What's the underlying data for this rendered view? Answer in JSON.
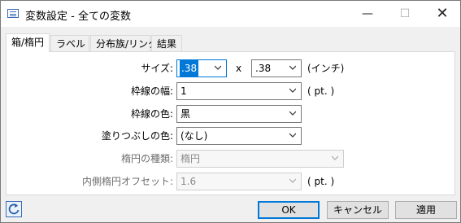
{
  "window": {
    "title": "変数設定 - 全ての変数"
  },
  "titlebar": {
    "minimize": "—",
    "maximize": "☐",
    "close": "✕"
  },
  "tabs": [
    {
      "label": "箱/楕円",
      "active": true
    },
    {
      "label": "ラベル",
      "active": false
    },
    {
      "label": "分布族/リンク",
      "active": false
    },
    {
      "label": "結果",
      "active": false
    }
  ],
  "form": {
    "size": {
      "label": "サイズ:",
      "w": ".38",
      "sep": "x",
      "h": ".38",
      "unit": "(インチ)"
    },
    "border_width": {
      "label": "枠線の幅:",
      "value": "1",
      "unit": "( pt. )"
    },
    "border_color": {
      "label": "枠線の色:",
      "value": "黒"
    },
    "fill_color": {
      "label": "塗りつぶしの色:",
      "value": "(なし)"
    },
    "ellipse_type": {
      "label": "楕円の種類:",
      "value": "楕円"
    },
    "inner_offset": {
      "label": "内側楕円オフセット:",
      "value": "1.6",
      "unit": "( pt. )"
    }
  },
  "footer": {
    "ok": "OK",
    "cancel": "キャンセル",
    "apply": "適用"
  },
  "colors": {
    "accent": "#0078d7"
  }
}
